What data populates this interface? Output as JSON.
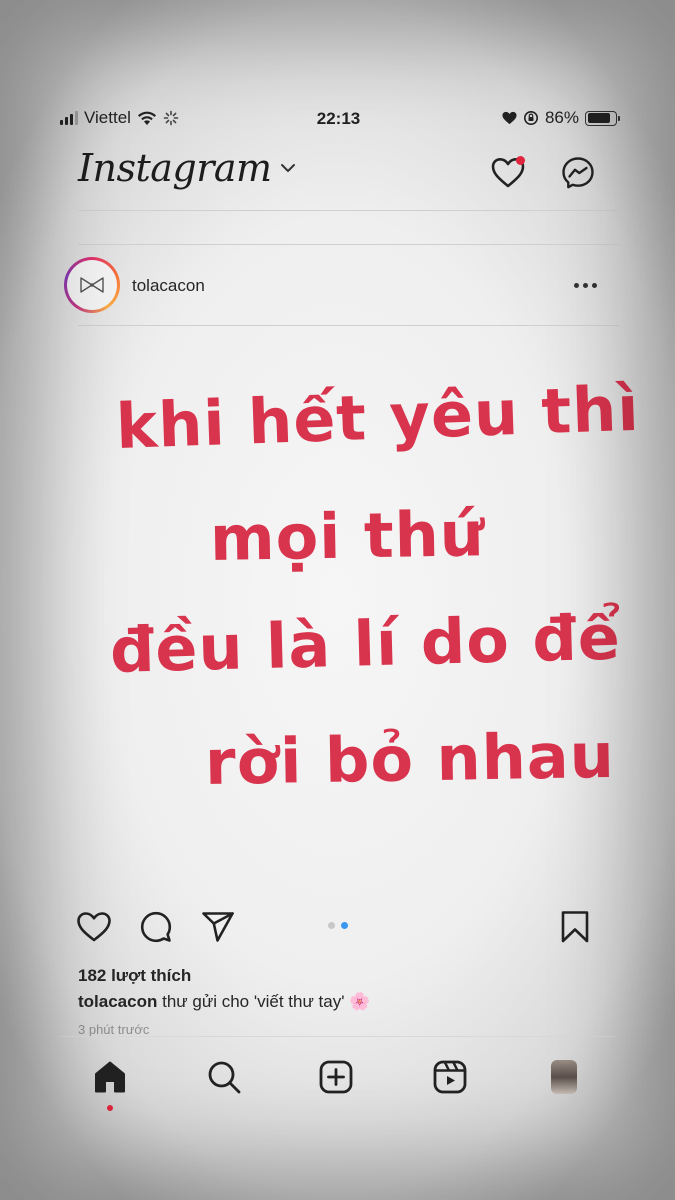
{
  "status_bar": {
    "carrier": "Viettel",
    "time": "22:13",
    "battery": "86%",
    "battery_level": 0.86,
    "icons": [
      "signal-icon",
      "wifi-icon",
      "loading-icon",
      "heart-icon",
      "rotation-lock-icon",
      "battery-icon"
    ]
  },
  "header": {
    "brand": "Instagram",
    "icons": [
      "chevron-down-icon",
      "activity-heart-icon",
      "messenger-icon"
    ],
    "notification_color": "#e0263c"
  },
  "post": {
    "username": "tolacacon",
    "handwritten_lines": [
      "khi hết yêu thì",
      "mọi thứ",
      "đều là lí do để",
      "rời bỏ nhau"
    ],
    "handwriting_color": "#d9344e",
    "carousel": {
      "count": 2,
      "active": 2,
      "active_color": "#3897f0"
    },
    "likes": "182 lượt thích",
    "caption_user": "tolacacon",
    "caption_text": "thư gửi cho 'viết thư tay' 🌸",
    "time_ago": "3 phút trước"
  },
  "tab_bar": {
    "items": [
      "home-icon",
      "search-icon",
      "new-post-icon",
      "reels-icon",
      "profile-icon"
    ]
  }
}
